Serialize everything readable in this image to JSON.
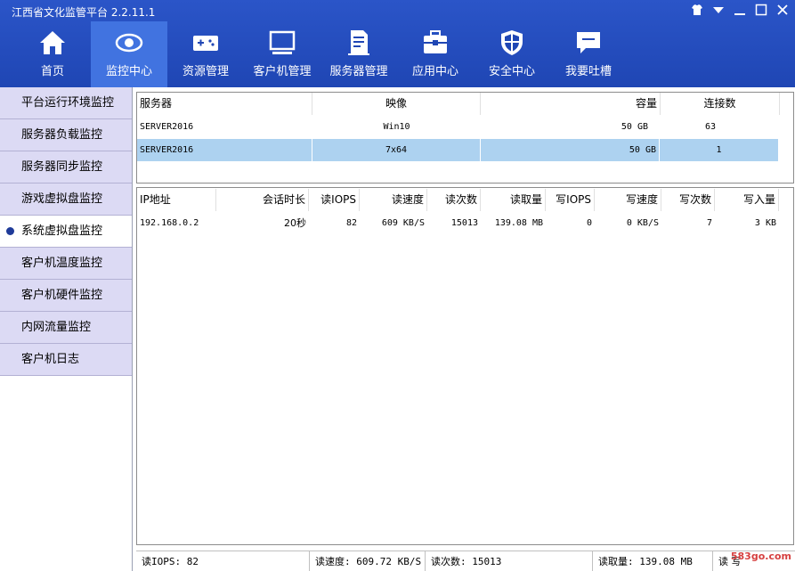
{
  "window": {
    "title": "江西省文化监管平台 2.2.11.1"
  },
  "nav": {
    "items": [
      {
        "label": "首页",
        "icon": "home-icon"
      },
      {
        "label": "监控中心",
        "icon": "eye-icon",
        "active": true
      },
      {
        "label": "资源管理",
        "icon": "gamepad-icon"
      },
      {
        "label": "客户机管理",
        "icon": "monitor-icon"
      },
      {
        "label": "服务器管理",
        "icon": "server-icon"
      },
      {
        "label": "应用中心",
        "icon": "toolbox-icon"
      },
      {
        "label": "安全中心",
        "icon": "shield-icon"
      },
      {
        "label": "我要吐槽",
        "icon": "comment-icon"
      }
    ]
  },
  "sidebar": {
    "items": [
      {
        "label": "平台运行环境监控"
      },
      {
        "label": "服务器负载监控"
      },
      {
        "label": "服务器同步监控"
      },
      {
        "label": "游戏虚拟盘监控"
      },
      {
        "label": "系统虚拟盘监控",
        "active": true
      },
      {
        "label": "客户机温度监控"
      },
      {
        "label": "客户机硬件监控"
      },
      {
        "label": "内网流量监控"
      },
      {
        "label": "客户机日志"
      }
    ]
  },
  "server_table": {
    "headers": [
      "服务器",
      "映像",
      "容量",
      "连接数"
    ],
    "rows": [
      [
        "SERVER2016",
        "Win10",
        "50 GB",
        "63"
      ],
      [
        "SERVER2016",
        "7x64",
        "50 GB",
        "1"
      ]
    ]
  },
  "client_table": {
    "headers": [
      "IP地址",
      "会话时长",
      "读IOPS",
      "读速度",
      "读次数",
      "读取量",
      "写IOPS",
      "写速度",
      "写次数",
      "写入量"
    ],
    "rows": [
      [
        "192.168.0.2",
        "20秒",
        "82",
        "609 KB/S",
        "15013",
        "139.08 MB",
        "0",
        "0 KB/S",
        "7",
        "3 KB"
      ]
    ]
  },
  "status": {
    "read_iops": "读IOPS: 82",
    "read_speed": "读速度: 609.72 KB/S",
    "read_count": "读次数: 15013",
    "read_amount": "读取量: 139.08 MB",
    "write": "读 写"
  },
  "watermark": "583go.com"
}
